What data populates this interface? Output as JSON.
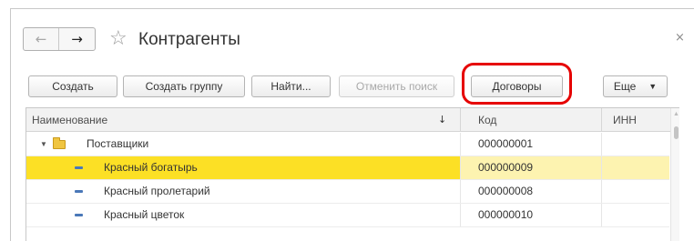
{
  "window": {
    "title": "Контрагенты",
    "nav": {
      "back_icon": "←",
      "forward_icon": "→"
    },
    "favorite_icon": "☆",
    "close_icon": "×"
  },
  "toolbar": {
    "create": "Создать",
    "create_group": "Создать группу",
    "find": "Найти...",
    "cancel_search": "Отменить поиск",
    "contracts": "Договоры",
    "more": "Еще",
    "more_caret": "▼"
  },
  "table": {
    "columns": {
      "name": "Наименование",
      "code": "Код",
      "inn": "ИНН"
    },
    "sort_icon": "↓",
    "rows": [
      {
        "name": "Поставщики",
        "code": "000000001",
        "inn": "",
        "type": "group",
        "expand_icon": "▼"
      },
      {
        "name": "Красный богатырь",
        "code": "000000009",
        "inn": "",
        "type": "item"
      },
      {
        "name": "Красный пролетарий",
        "code": "000000008",
        "inn": "",
        "type": "item"
      },
      {
        "name": "Красный цветок",
        "code": "000000010",
        "inn": "",
        "type": "item"
      }
    ],
    "selected_row": 1
  },
  "colors": {
    "selection": "#fce025",
    "selection_light": "#fdf3b0",
    "annotation": "#e60000"
  }
}
